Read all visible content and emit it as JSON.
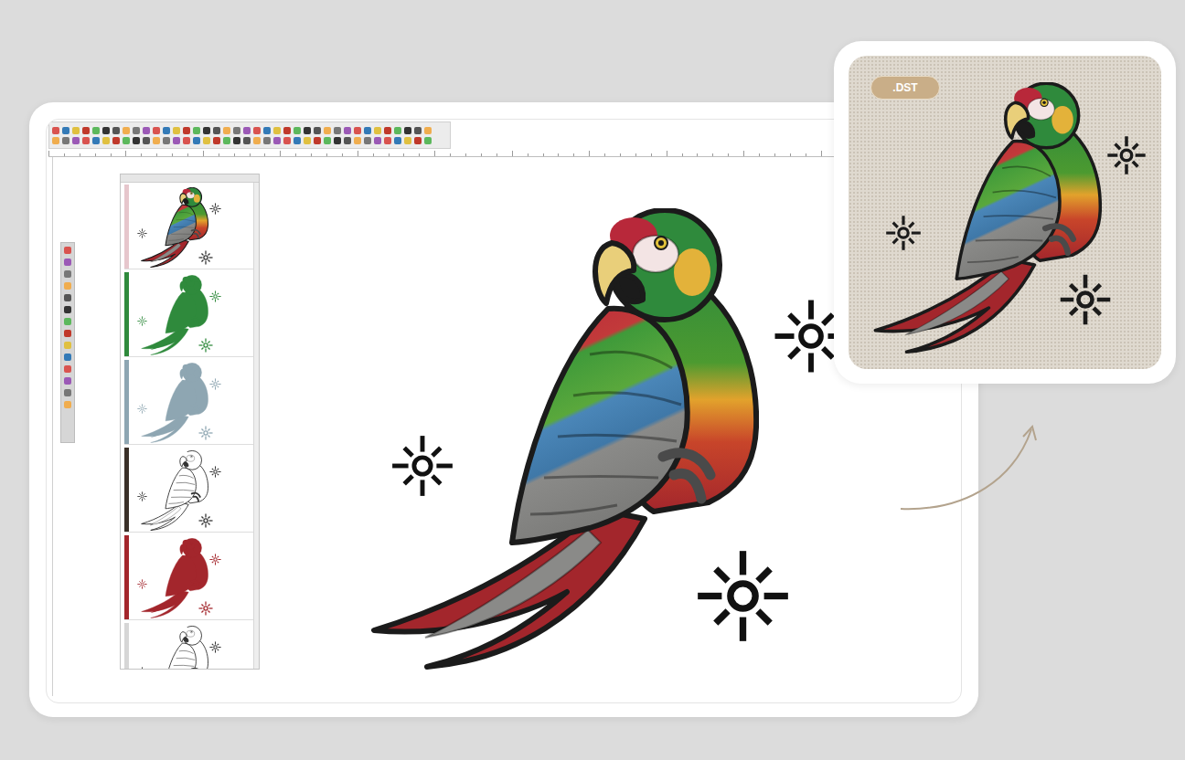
{
  "badge": ".DST",
  "layers": [
    {
      "kind": "full",
      "color": "#e6c6cc"
    },
    {
      "kind": "silhouette",
      "color": "#2f8a3c"
    },
    {
      "kind": "silhouette",
      "color": "#8ea6b2"
    },
    {
      "kind": "outline",
      "color": "#3a3028"
    },
    {
      "kind": "silhouette",
      "color": "#a3262c"
    },
    {
      "kind": "outline",
      "color": "#d6d6d6"
    }
  ]
}
